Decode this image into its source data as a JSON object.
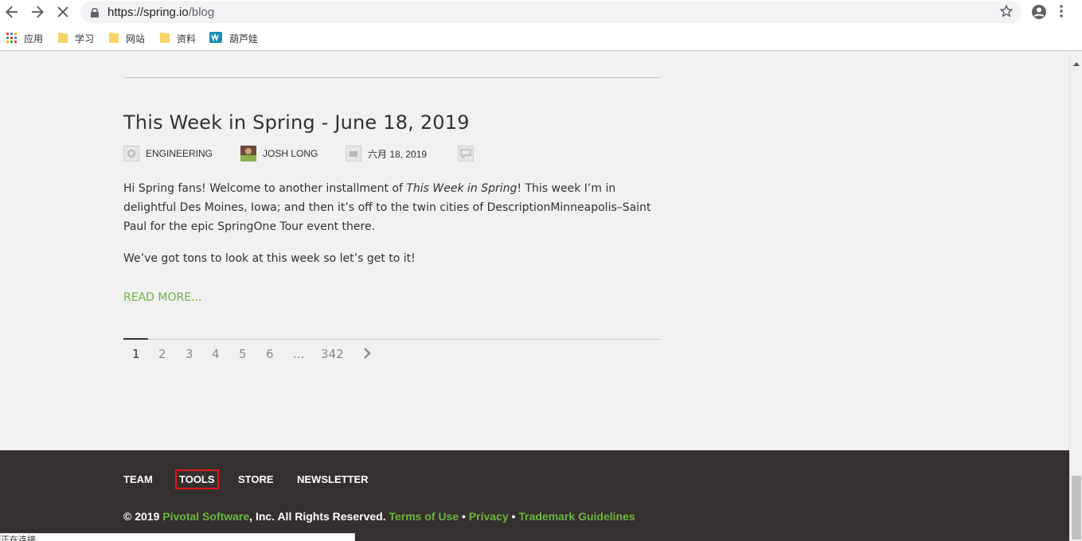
{
  "browser": {
    "url_host": "https://spring.io",
    "url_path": "/blog",
    "bookmarks": [
      {
        "label": "应用",
        "icon": "apps-grid-icon"
      },
      {
        "label": "学习",
        "icon": "folder-icon"
      },
      {
        "label": "网站",
        "icon": "folder-icon"
      },
      {
        "label": "资料",
        "icon": "folder-icon"
      },
      {
        "label": "葫芦娃",
        "icon": "site-favicon-icon"
      }
    ]
  },
  "post": {
    "title": "This Week in Spring - June 18, 2019",
    "category": "ENGINEERING",
    "author": "JOSH LONG",
    "date": "六月 18, 2019",
    "paragraph1_a": "Hi Spring fans! Welcome to another installment of ",
    "paragraph1_em": "This Week in Spring",
    "paragraph1_b": "! This week I’m in delightful Des Moines, Iowa; and then it’s off to the twin cities of DescriptionMinneapolis–Saint Paul for the epic SpringOne Tour event there.",
    "paragraph2": "We’ve got tons to look at this week so let’s get to it!",
    "read_more": "READ MORE..."
  },
  "pagination": {
    "pages": [
      "1",
      "2",
      "3",
      "4",
      "5",
      "6",
      "...",
      "342"
    ],
    "current": "1"
  },
  "footer": {
    "nav": [
      "TEAM",
      "TOOLS",
      "STORE",
      "NEWSLETTER"
    ],
    "copyright_prefix": "© 2019 ",
    "company": "Pivotal Software",
    "copyright_suffix": ", Inc. All Rights Reserved. ",
    "terms": "Terms of Use",
    "sep1": " • ",
    "privacy": "Privacy",
    "sep2": " • ",
    "trademark": "Trademark Guidelines"
  },
  "status_text": "正在连接...",
  "colors": {
    "accent_green": "#6db33f",
    "footer_bg": "#34302d",
    "highlight_red": "#e0161c"
  }
}
